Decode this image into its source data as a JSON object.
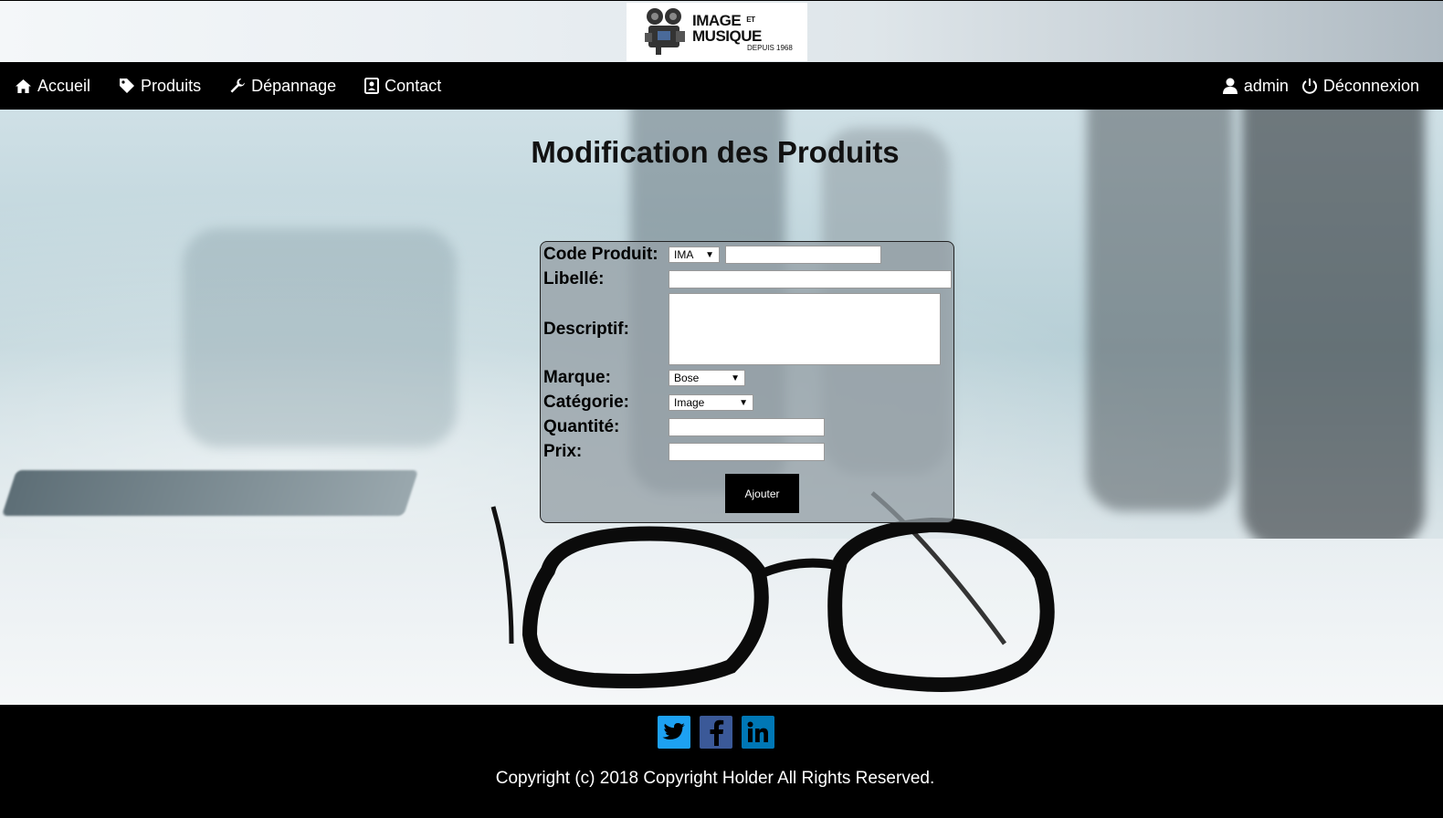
{
  "logo": {
    "line1": "IMAGE",
    "line1_small": "ET",
    "line2": "MUSIQUE",
    "line3": "DEPUIS 1968"
  },
  "nav": {
    "home": "Accueil",
    "products": "Produits",
    "repair": "Dépannage",
    "contact": "Contact",
    "user": "admin",
    "logout": "Déconnexion"
  },
  "page": {
    "title": "Modification des Produits"
  },
  "form": {
    "code_label": "Code Produit:",
    "code_prefix": "IMA",
    "code_value": "",
    "libelle_label": "Libellé:",
    "libelle_value": "",
    "descriptif_label": "Descriptif:",
    "descriptif_value": "",
    "marque_label": "Marque:",
    "marque_value": "Bose",
    "categorie_label": "Catégorie:",
    "categorie_value": "Image",
    "quantite_label": "Quantité:",
    "quantite_value": "",
    "prix_label": "Prix:",
    "prix_value": "",
    "submit_label": "Ajouter"
  },
  "footer": {
    "social": [
      "twitter-icon",
      "facebook-icon",
      "linkedin-icon"
    ],
    "copyright": "Copyright (c) 2018 Copyright Holder All Rights Reserved."
  },
  "colors": {
    "nav_bg": "#000000",
    "twitter": "#1da1f2",
    "facebook": "#3b5998",
    "linkedin": "#0077b5"
  }
}
